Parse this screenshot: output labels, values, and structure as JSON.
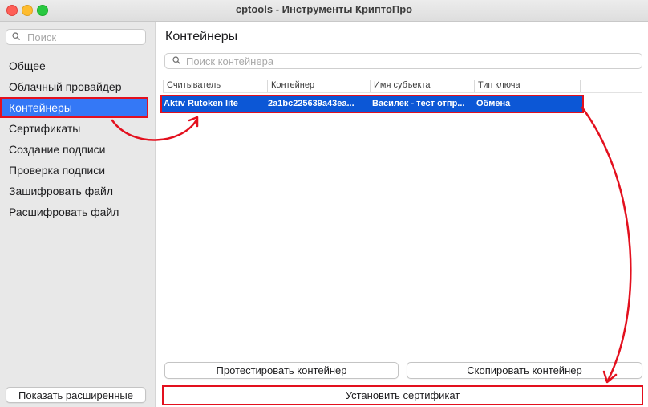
{
  "window": {
    "title": "cptools - Инструменты КриптоПро"
  },
  "sidebar": {
    "search_placeholder": "Поиск",
    "items": [
      {
        "label": "Общее"
      },
      {
        "label": "Облачный провайдер"
      },
      {
        "label": "Контейнеры"
      },
      {
        "label": "Сертификаты"
      },
      {
        "label": "Создание подписи"
      },
      {
        "label": "Проверка подписи"
      },
      {
        "label": "Зашифровать файл"
      },
      {
        "label": "Расшифровать файл"
      }
    ],
    "selected_index": 2,
    "show_extended_label": "Показать расширенные"
  },
  "main": {
    "title": "Контейнеры",
    "search_placeholder": "Поиск контейнера",
    "table": {
      "columns": [
        "Считыватель",
        "Контейнер",
        "Имя субъекта",
        "Тип ключа"
      ],
      "rows": [
        [
          "Aktiv Rutoken lite",
          "2a1bc225639a43ea...",
          "Василек - тест отпр...",
          "Обмена"
        ]
      ]
    },
    "buttons": {
      "test": "Протестировать контейнер",
      "copy": "Скопировать контейнер",
      "install": "Установить сертификат"
    }
  },
  "colors": {
    "accent": "#3478f6",
    "row_selected": "#0c57d6",
    "annotation": "#e3101e",
    "sidebar_bg": "#e8e8e8"
  },
  "icons": {
    "search": "search-icon",
    "close": "close-icon",
    "minimize": "minimize-icon",
    "zoom": "zoom-icon"
  }
}
